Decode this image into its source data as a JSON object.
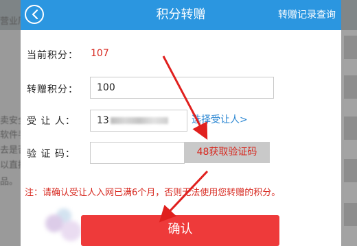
{
  "header": {
    "back_icon": "chevron-left-icon",
    "title": "积分转赠",
    "records_link": "转赠记录查询"
  },
  "form": {
    "current_points_label": "当前积分：",
    "current_points_value": "107",
    "transfer_points_label": "转赠积分：",
    "transfer_points_value": "100",
    "recipient_label": "受 让 人：",
    "recipient_value_prefix": "13",
    "select_recipient_link": "选择受让人>",
    "verification_label": "验 证 码：",
    "verification_value": "",
    "get_code_button": "48获取验证码"
  },
  "notice": "注：请确认受让人入网已满6个月，否则无法使用您转赠的积分。",
  "confirm_button": "确认",
  "background_text": [
    "营业厅",
    "卖安全",
    "软件手",
    "去是否",
    "以直接",
    "品。"
  ],
  "colors": {
    "titlebar": "#2b96e0",
    "accent_red": "#d7281f",
    "confirm_button": "#ee3a3a",
    "link_blue": "#2a86d2",
    "annotation_arrow": "#e0201e"
  }
}
